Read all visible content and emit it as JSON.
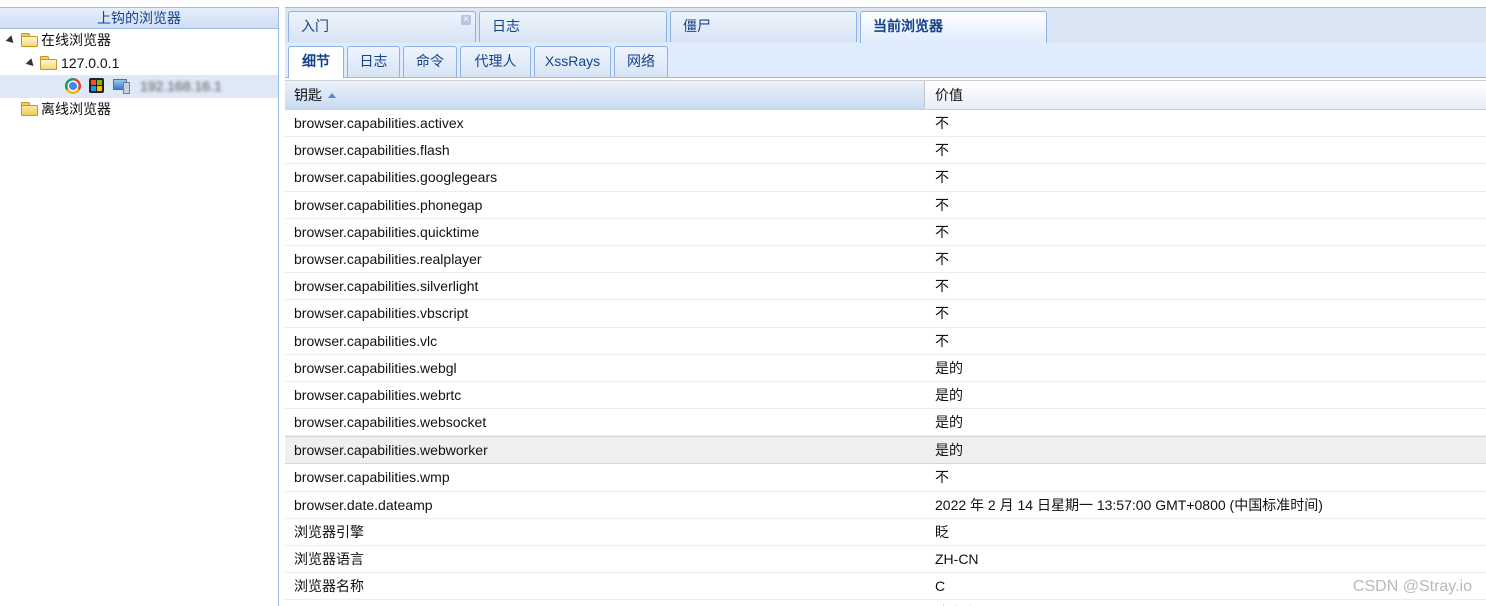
{
  "left_panel": {
    "title": "上钩的浏览器",
    "tree": {
      "online_label": "在线浏览器",
      "host_label": "127.0.0.1",
      "browser_ip": "192.168.16.1",
      "offline_label": "离线浏览器"
    }
  },
  "main_tabs": [
    {
      "label": "入门",
      "closable": true
    },
    {
      "label": "日志"
    },
    {
      "label": "僵尸"
    },
    {
      "label": "当前浏览器",
      "active": true
    }
  ],
  "sub_tabs": [
    {
      "label": "细节",
      "active": true
    },
    {
      "label": "日志"
    },
    {
      "label": "命令"
    },
    {
      "label": "代理人"
    },
    {
      "label": "XssRays"
    },
    {
      "label": "网络"
    }
  ],
  "grid": {
    "col_key": "钥匙",
    "col_value": "价值",
    "sort": "ascending",
    "rows": [
      {
        "key": "browser.capabilities.activex",
        "value": "不"
      },
      {
        "key": "browser.capabilities.flash",
        "value": "不"
      },
      {
        "key": "browser.capabilities.googlegears",
        "value": "不"
      },
      {
        "key": "browser.capabilities.phonegap",
        "value": "不"
      },
      {
        "key": "browser.capabilities.quicktime",
        "value": "不"
      },
      {
        "key": "browser.capabilities.realplayer",
        "value": "不"
      },
      {
        "key": "browser.capabilities.silverlight",
        "value": "不"
      },
      {
        "key": "browser.capabilities.vbscript",
        "value": "不"
      },
      {
        "key": "browser.capabilities.vlc",
        "value": "不"
      },
      {
        "key": "browser.capabilities.webgl",
        "value": "是的"
      },
      {
        "key": "browser.capabilities.webrtc",
        "value": "是的"
      },
      {
        "key": "browser.capabilities.websocket",
        "value": "是的"
      },
      {
        "key": "browser.capabilities.webworker",
        "value": "是的"
      },
      {
        "key": "browser.capabilities.wmp",
        "value": "不"
      },
      {
        "key": "browser.date.dateamp",
        "value": "2022 年 2 月 14 日星期一 13:57:00 GMT+0800 (中国标准时间)"
      },
      {
        "key": "浏览器引擎",
        "value": "眨"
      },
      {
        "key": "浏览器语言",
        "value": "ZH-CN"
      },
      {
        "key": "浏览器名称",
        "value": "C"
      },
      {
        "key": "browser.name.friendly",
        "value": "铬合金"
      }
    ]
  },
  "watermark": "CSDN @Stray.io",
  "icons": [
    "expand-arrow-icon",
    "folder-open-icon",
    "folder-icon",
    "chrome-icon",
    "windows-icon",
    "computer-icon",
    "close-icon",
    "sort-asc-icon"
  ]
}
